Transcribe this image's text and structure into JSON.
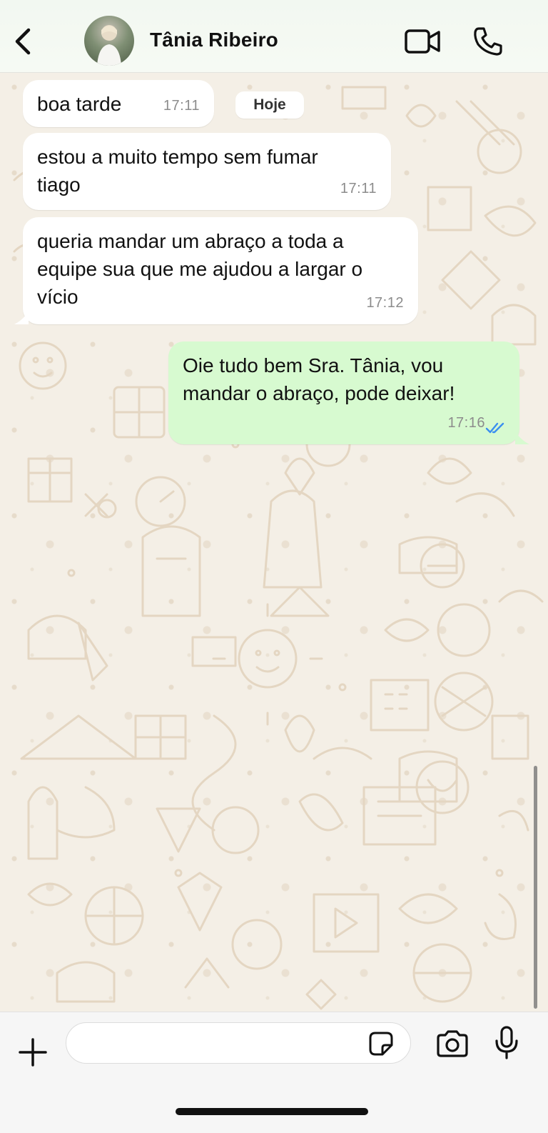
{
  "header": {
    "contact_name": "Tânia Ribeiro",
    "back_icon": "chevron-left-icon",
    "video_icon": "video-camera-icon",
    "call_icon": "phone-icon"
  },
  "chat": {
    "date_chip": "Hoje",
    "messages": [
      {
        "direction": "in",
        "text": "boa tarde",
        "time": "17:11"
      },
      {
        "direction": "in",
        "text": "estou a muito tempo sem fumar tiago",
        "time": "17:11"
      },
      {
        "direction": "in",
        "text": "queria mandar um abraço a toda a equipe sua que me ajudou a largar o vício",
        "time": "17:12"
      },
      {
        "direction": "out",
        "text": "Oie tudo bem Sra. Tânia, vou mandar o abraço, pode deixar!",
        "time": "17:16",
        "status": "read"
      }
    ]
  },
  "composer": {
    "input_value": "",
    "plus_icon": "plus-icon",
    "sticker_icon": "sticker-icon",
    "camera_icon": "camera-icon",
    "mic_icon": "microphone-icon"
  },
  "colors": {
    "incoming_bubble": "#ffffff",
    "outgoing_bubble": "#d7fad0",
    "chat_background": "#f4efe6",
    "read_receipt": "#3a8ff0"
  }
}
